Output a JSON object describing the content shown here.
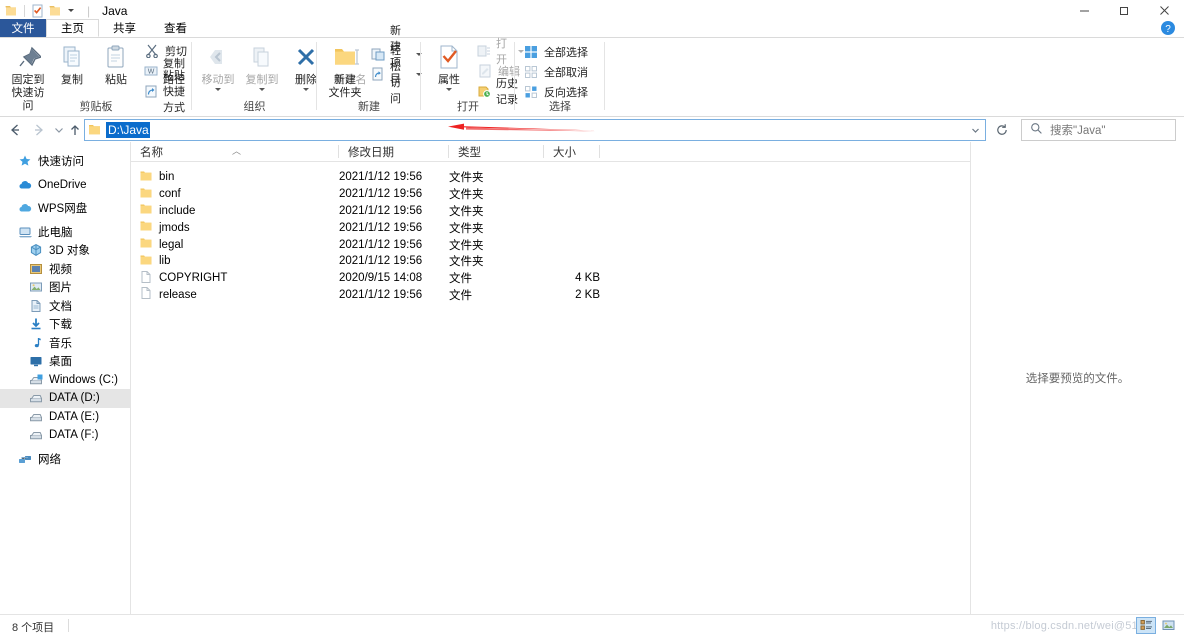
{
  "window": {
    "title": "Java",
    "quick_access": [
      {
        "name": "folder-icon",
        "label": "属性"
      },
      {
        "name": "properties-icon",
        "label": "属性"
      },
      {
        "name": "new-folder-icon",
        "label": "新建文件夹"
      },
      {
        "name": "customize-caret-icon",
        "label": "自定义快速访问工具栏"
      }
    ],
    "controls": {
      "minimize": "最小化",
      "maximize": "最大化",
      "close": "关闭"
    },
    "help_label": "帮助"
  },
  "tabs": [
    {
      "label": "文件",
      "kind": "file"
    },
    {
      "label": "主页",
      "kind": "active"
    },
    {
      "label": "共享",
      "kind": "normal"
    },
    {
      "label": "查看",
      "kind": "normal"
    }
  ],
  "ribbon": {
    "groups": [
      {
        "label": "剪贴板",
        "big": [
          {
            "label": "固定到\n快速访问",
            "icon": "pin-icon",
            "disabled": false
          },
          {
            "label": "复制",
            "icon": "copy-icon",
            "disabled": false
          },
          {
            "label": "粘贴",
            "icon": "paste-icon",
            "disabled": false
          }
        ],
        "small": [
          {
            "label": "剪切",
            "icon": "cut-icon",
            "disabled": false
          },
          {
            "label": "复制路径",
            "icon": "copy-path-icon",
            "disabled": false
          },
          {
            "label": "粘贴快捷方式",
            "icon": "paste-shortcut-icon",
            "disabled": false
          }
        ]
      },
      {
        "label": "组织",
        "big": [
          {
            "label": "移动到",
            "icon": "move-to-icon",
            "disabled": true,
            "caret": true
          },
          {
            "label": "复制到",
            "icon": "copy-to-icon",
            "disabled": true,
            "caret": true
          },
          {
            "label": "删除",
            "icon": "delete-icon",
            "disabled": false,
            "caret": true
          },
          {
            "label": "重命名",
            "icon": "rename-icon",
            "disabled": true
          }
        ],
        "small": []
      },
      {
        "label": "新建",
        "big": [
          {
            "label": "新建\n文件夹",
            "icon": "new-folder-icon",
            "disabled": false
          }
        ],
        "small": [
          {
            "label": "新建项目",
            "icon": "new-item-icon",
            "disabled": false,
            "caret": true
          },
          {
            "label": "轻松访问",
            "icon": "easy-access-icon",
            "disabled": false,
            "caret": true
          }
        ]
      },
      {
        "label": "打开",
        "big": [
          {
            "label": "属性",
            "icon": "properties-icon",
            "disabled": false,
            "caret": true
          }
        ],
        "small": [
          {
            "label": "打开",
            "icon": "open-icon",
            "disabled": true,
            "caret": true
          },
          {
            "label": "编辑",
            "icon": "edit-icon",
            "disabled": true
          },
          {
            "label": "历史记录",
            "icon": "history-icon",
            "disabled": false
          }
        ]
      },
      {
        "label": "选择",
        "big": [],
        "small": [
          {
            "label": "全部选择",
            "icon": "select-all-icon",
            "disabled": false
          },
          {
            "label": "全部取消",
            "icon": "select-none-icon",
            "disabled": false
          },
          {
            "label": "反向选择",
            "icon": "invert-selection-icon",
            "disabled": false
          }
        ]
      }
    ]
  },
  "nav": {
    "back": "后退",
    "forward": "前进",
    "recent": "最近的位置",
    "up": "上移到",
    "address_value": "D:\\Java",
    "address_dropdown": "展开",
    "refresh": "刷新",
    "search_placeholder": "搜索\"Java\""
  },
  "sidebar": {
    "items": [
      {
        "label": "快速访问",
        "icon": "star-icon",
        "indent": 0,
        "selected": false
      },
      {
        "label": "OneDrive",
        "icon": "onedrive-cloud-icon",
        "indent": 0,
        "selected": false
      },
      {
        "label": "WPS网盘",
        "icon": "wps-cloud-icon",
        "indent": 0,
        "selected": false
      },
      {
        "label": "此电脑",
        "icon": "this-pc-icon",
        "indent": 0,
        "selected": false
      },
      {
        "label": "3D 对象",
        "icon": "3d-objects-icon",
        "indent": 1,
        "selected": false
      },
      {
        "label": "视频",
        "icon": "videos-icon",
        "indent": 1,
        "selected": false
      },
      {
        "label": "图片",
        "icon": "pictures-icon",
        "indent": 1,
        "selected": false
      },
      {
        "label": "文档",
        "icon": "documents-icon",
        "indent": 1,
        "selected": false
      },
      {
        "label": "下载",
        "icon": "downloads-icon",
        "indent": 1,
        "selected": false
      },
      {
        "label": "音乐",
        "icon": "music-icon",
        "indent": 1,
        "selected": false
      },
      {
        "label": "桌面",
        "icon": "desktop-icon",
        "indent": 1,
        "selected": false
      },
      {
        "label": "Windows (C:)",
        "icon": "os-drive-icon",
        "indent": 1,
        "selected": false
      },
      {
        "label": "DATA (D:)",
        "icon": "drive-icon",
        "indent": 1,
        "selected": true
      },
      {
        "label": "DATA (E:)",
        "icon": "drive-icon",
        "indent": 1,
        "selected": false
      },
      {
        "label": "DATA (F:)",
        "icon": "drive-icon",
        "indent": 1,
        "selected": false
      },
      {
        "label": "网络",
        "icon": "network-icon",
        "indent": 0,
        "selected": false
      }
    ]
  },
  "file_list": {
    "columns": [
      {
        "label": "名称",
        "sorted": true
      },
      {
        "label": "修改日期",
        "sorted": false
      },
      {
        "label": "类型",
        "sorted": false
      },
      {
        "label": "大小",
        "sorted": false
      }
    ],
    "rows": [
      {
        "name": "bin",
        "date": "2021/1/12 19:56",
        "type": "文件夹",
        "size": "",
        "icon": "folder-icon"
      },
      {
        "name": "conf",
        "date": "2021/1/12 19:56",
        "type": "文件夹",
        "size": "",
        "icon": "folder-icon"
      },
      {
        "name": "include",
        "date": "2021/1/12 19:56",
        "type": "文件夹",
        "size": "",
        "icon": "folder-icon"
      },
      {
        "name": "jmods",
        "date": "2021/1/12 19:56",
        "type": "文件夹",
        "size": "",
        "icon": "folder-icon"
      },
      {
        "name": "legal",
        "date": "2021/1/12 19:56",
        "type": "文件夹",
        "size": "",
        "icon": "folder-icon"
      },
      {
        "name": "lib",
        "date": "2021/1/12 19:56",
        "type": "文件夹",
        "size": "",
        "icon": "folder-icon"
      },
      {
        "name": "COPYRIGHT",
        "date": "2020/9/15 14:08",
        "type": "文件",
        "size": "4 KB",
        "icon": "file-icon"
      },
      {
        "name": "release",
        "date": "2021/1/12 19:56",
        "type": "文件",
        "size": "2 KB",
        "icon": "file-icon"
      }
    ]
  },
  "preview": {
    "placeholder": "选择要预览的文件。"
  },
  "status": {
    "item_count": "8 个项目",
    "view_details": "详细信息",
    "view_large_icons": "大图标"
  },
  "watermark": {
    "text": "https://blog.csdn.net/wei@51C"
  },
  "colors": {
    "file_tab": "#2b579a",
    "selection_blue": "#0b6ccc",
    "address_border": "#7aafe0",
    "annotation_red": "#ee2222",
    "sidebar_selected": "#e5e5e5"
  }
}
